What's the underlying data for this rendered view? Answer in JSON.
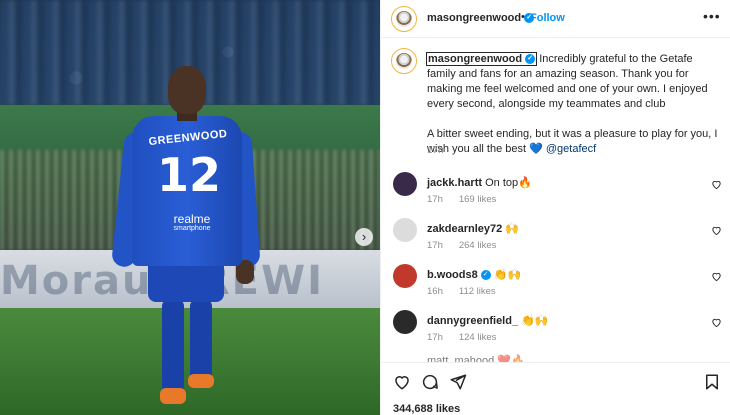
{
  "post": {
    "username": "masongreenwood",
    "follow_label": "Follow",
    "dot": "•",
    "more": "•••",
    "caption_p1": "Incredibly grateful to the Getafe family and fans for an amazing season. Thank you for making me feel welcomed and one of your own. I enjoyed every second, alongside my teammates and club",
    "caption_p2_text": "A bitter sweet ending, but it was a pleasure to play for you, I wish you all the best",
    "caption_heart": "💙",
    "caption_mention": "@getafecf",
    "time": "17h",
    "likes": "344,688 likes"
  },
  "photo": {
    "jersey_name": "GREENWOOD",
    "jersey_number": "12",
    "sponsor": "realme",
    "sponsor_sub": "smartphone",
    "board_text": "Moraun  REWI",
    "next_arrow": "›"
  },
  "comments": [
    {
      "user": "jackk.hartt",
      "text": "On top🔥",
      "time": "17h",
      "likes": "169 likes",
      "verified": false,
      "avatar_color": "#3a2a4a"
    },
    {
      "user": "zakdearnley72",
      "text": "🙌",
      "time": "17h",
      "likes": "264 likes",
      "verified": false,
      "avatar_color": "#dcdcdc"
    },
    {
      "user": "b.woods8",
      "text": "👏🙌",
      "time": "16h",
      "likes": "112 likes",
      "verified": true,
      "avatar_color": "#c0392b"
    },
    {
      "user": "dannygreenfield_",
      "text": "👏🙌",
      "time": "17h",
      "likes": "124 likes",
      "verified": false,
      "avatar_color": "#2a2a2a"
    }
  ],
  "peek_comment": "matt_mahood  ❤️🔥",
  "colors": {
    "accent": "#0095f6",
    "verified": "#0095f6",
    "meta_grey": "#8e8e8e",
    "jersey_blue": "#2254c6"
  },
  "icons": [
    "heart-icon",
    "comment-icon",
    "share-icon",
    "bookmark-icon",
    "more-options-icon",
    "verified-badge-icon",
    "carousel-next-icon"
  ]
}
